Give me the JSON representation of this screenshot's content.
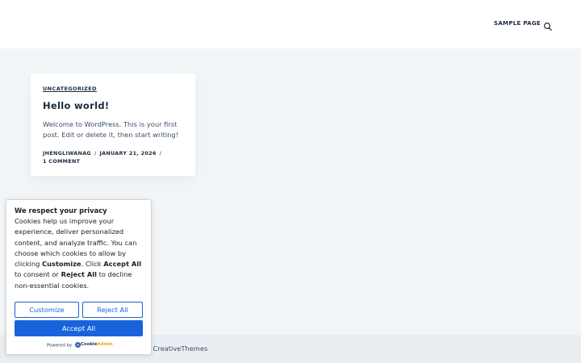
{
  "header": {
    "nav_link": "SAMPLE PAGE",
    "search_icon": "search-icon"
  },
  "post": {
    "category": "UNCATEGORIZED",
    "title": "Hello world!",
    "excerpt": "Welcome to WordPress. This is your first post. Edit or delete it, then start writing!",
    "author": "JHENGLIWANAG",
    "separator": "/",
    "date": "JANUARY 21, 2026",
    "comments": "1 COMMENT"
  },
  "footer": {
    "text": "y CreativeThemes"
  },
  "cookie_banner": {
    "title": "We respect your privacy",
    "body_1": "Cookies help us improve your experience, deliver personalized content, and analyze traffic. You can choose which cookies to allow by clicking ",
    "body_customize": "Customize",
    "body_2": ". Click ",
    "body_accept": "Accept All",
    "body_3": " to consent or ",
    "body_reject": "Reject All",
    "body_4": " to decline non-essential cookies.",
    "customize_label": "Customize",
    "reject_label": "Reject All",
    "accept_label": "Accept All",
    "powered_by": "Powered by",
    "brand_part1": "Cookie",
    "brand_part2": "Admin"
  },
  "colors": {
    "accent": "#1863dc",
    "page_background": "#f2f5f7",
    "heading": "#192a3d"
  }
}
